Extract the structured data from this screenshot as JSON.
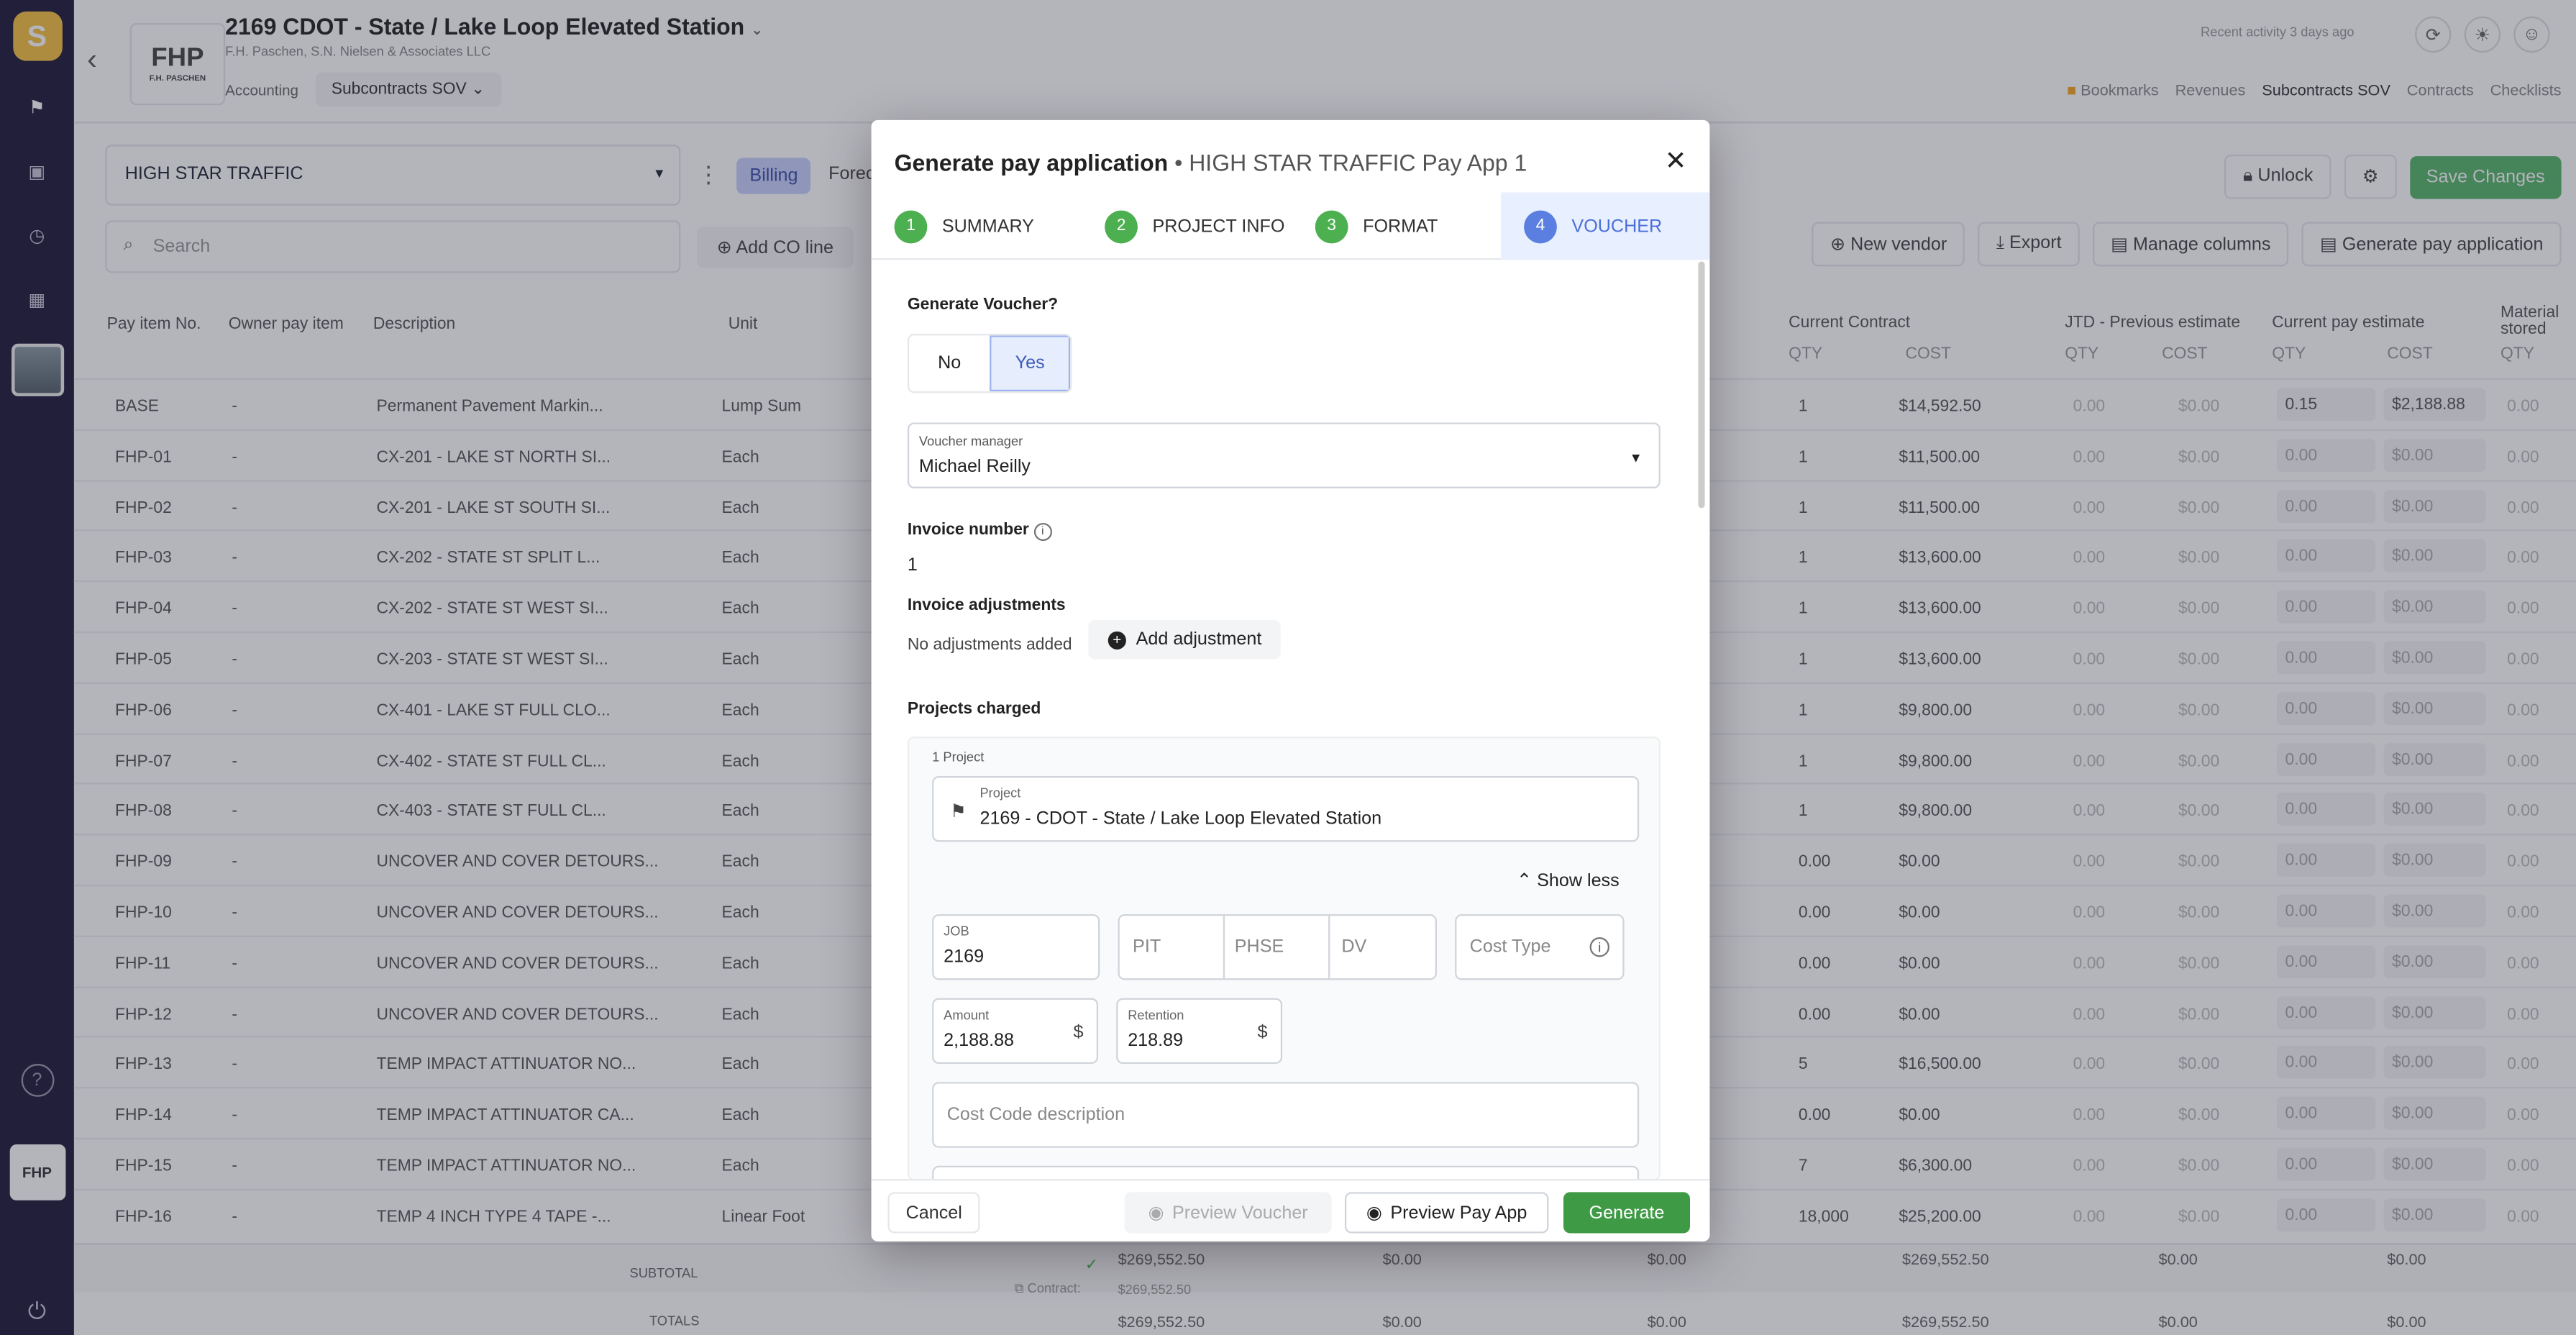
{
  "topbar": {
    "project_title": "2169 CDOT - State / Lake Loop Elevated Station",
    "project_company": "F.H. Paschen, S.N. Nielsen & Associates LLC",
    "logo_text": "FHP",
    "logo_sub": "F.H. PASCHEN",
    "crumb_accounting": "Accounting",
    "crumb_subcontracts": "Subcontracts SOV",
    "recent": "Recent activity 3 days ago",
    "nav": [
      "Bookmarks",
      "Revenues",
      "Subcontracts SOV",
      "Contracts",
      "Checklists"
    ]
  },
  "toolbar": {
    "vendor": "HIGH STAR TRAFFIC",
    "billing_tab": "Billing",
    "forecast_tab": "Forec",
    "search_placeholder": "Search",
    "add_co": "Add CO line",
    "unlock": "Unlock",
    "save": "Save Changes",
    "new_vendor": "New vendor",
    "export": "Export",
    "manage_columns": "Manage columns",
    "generate": "Generate pay application"
  },
  "table": {
    "headers": {
      "pay_item": "Pay item No.",
      "owner": "Owner pay item",
      "desc": "Description",
      "unit": "Unit",
      "current_contract": "Current Contract",
      "jtd": "JTD - Previous estimate",
      "current_pay": "Current pay estimate",
      "material": "Material stored",
      "qty": "QTY",
      "cost": "COST"
    },
    "rows": [
      {
        "no": "BASE",
        "owner": "-",
        "desc": "Permanent Pavement Markin...",
        "unit": "Lump Sum",
        "qty": "1",
        "cost": "$14,592.50",
        "pq": "0.15",
        "pc": "$2,188.88"
      },
      {
        "no": "FHP-01",
        "owner": "-",
        "desc": "CX-201 - LAKE ST NORTH SI...",
        "unit": "Each",
        "qty": "1",
        "cost": "$11,500.00",
        "pq": "0.00",
        "pc": "$0.00"
      },
      {
        "no": "FHP-02",
        "owner": "-",
        "desc": "CX-201 - LAKE ST SOUTH SI...",
        "unit": "Each",
        "qty": "1",
        "cost": "$11,500.00",
        "pq": "0.00",
        "pc": "$0.00"
      },
      {
        "no": "FHP-03",
        "owner": "-",
        "desc": "CX-202 - STATE ST SPLIT L...",
        "unit": "Each",
        "qty": "1",
        "cost": "$13,600.00",
        "pq": "0.00",
        "pc": "$0.00"
      },
      {
        "no": "FHP-04",
        "owner": "-",
        "desc": "CX-202 - STATE ST WEST SI...",
        "unit": "Each",
        "qty": "1",
        "cost": "$13,600.00",
        "pq": "0.00",
        "pc": "$0.00"
      },
      {
        "no": "FHP-05",
        "owner": "-",
        "desc": "CX-203 - STATE ST WEST SI...",
        "unit": "Each",
        "qty": "1",
        "cost": "$13,600.00",
        "pq": "0.00",
        "pc": "$0.00"
      },
      {
        "no": "FHP-06",
        "owner": "-",
        "desc": "CX-401 - LAKE ST FULL CLO...",
        "unit": "Each",
        "qty": "1",
        "cost": "$9,800.00",
        "pq": "0.00",
        "pc": "$0.00"
      },
      {
        "no": "FHP-07",
        "owner": "-",
        "desc": "CX-402 - STATE ST FULL CL...",
        "unit": "Each",
        "qty": "1",
        "cost": "$9,800.00",
        "pq": "0.00",
        "pc": "$0.00"
      },
      {
        "no": "FHP-08",
        "owner": "-",
        "desc": "CX-403 - STATE ST FULL CL...",
        "unit": "Each",
        "qty": "1",
        "cost": "$9,800.00",
        "pq": "0.00",
        "pc": "$0.00"
      },
      {
        "no": "FHP-09",
        "owner": "-",
        "desc": "UNCOVER AND COVER DETOURS...",
        "unit": "Each",
        "qty": "0.00",
        "cost": "$0.00",
        "pq": "0.00",
        "pc": "$0.00"
      },
      {
        "no": "FHP-10",
        "owner": "-",
        "desc": "UNCOVER AND COVER DETOURS...",
        "unit": "Each",
        "qty": "0.00",
        "cost": "$0.00",
        "pq": "0.00",
        "pc": "$0.00"
      },
      {
        "no": "FHP-11",
        "owner": "-",
        "desc": "UNCOVER AND COVER DETOURS...",
        "unit": "Each",
        "qty": "0.00",
        "cost": "$0.00",
        "pq": "0.00",
        "pc": "$0.00"
      },
      {
        "no": "FHP-12",
        "owner": "-",
        "desc": "UNCOVER AND COVER DETOURS...",
        "unit": "Each",
        "qty": "0.00",
        "cost": "$0.00",
        "pq": "0.00",
        "pc": "$0.00"
      },
      {
        "no": "FHP-13",
        "owner": "-",
        "desc": "TEMP IMPACT ATTINUATOR NO...",
        "unit": "Each",
        "qty": "5",
        "cost": "$16,500.00",
        "pq": "0.00",
        "pc": "$0.00"
      },
      {
        "no": "FHP-14",
        "owner": "-",
        "desc": "TEMP IMPACT ATTINUATOR CA...",
        "unit": "Each",
        "qty": "0.00",
        "cost": "$0.00",
        "pq": "0.00",
        "pc": "$0.00"
      },
      {
        "no": "FHP-15",
        "owner": "-",
        "desc": "TEMP IMPACT ATTINUATOR NO...",
        "unit": "Each",
        "qty": "7",
        "cost": "$6,300.00",
        "pq": "0.00",
        "pc": "$0.00"
      },
      {
        "no": "FHP-16",
        "owner": "-",
        "desc": "TEMP 4 INCH TYPE 4 TAPE -...",
        "unit": "Linear Foot",
        "qty": "18,000",
        "cost": "$25,200.00",
        "pq": "0.00",
        "pc": "$0.00"
      }
    ],
    "jtd_zero_qty": "0.00",
    "jtd_zero_cost": "$0.00",
    "subtotal_label": "SUBTOTAL",
    "totals_label": "TOTALS",
    "contract_label": "Contract:",
    "sub_amount": "$269,552.50",
    "zero": "$0.00"
  },
  "modal": {
    "title": "Generate pay application",
    "subtitle": "• HIGH STAR TRAFFIC Pay App 1",
    "steps": [
      {
        "n": "1",
        "label": "SUMMARY"
      },
      {
        "n": "2",
        "label": "PROJECT INFO"
      },
      {
        "n": "3",
        "label": "FORMAT"
      },
      {
        "n": "4",
        "label": "VOUCHER"
      }
    ],
    "gen_voucher_label": "Generate Voucher?",
    "no": "No",
    "yes": "Yes",
    "voucher_manager_label": "Voucher manager",
    "voucher_manager": "Michael Reilly",
    "invoice_number_label": "Invoice number",
    "invoice_number": "1",
    "adjustments_label": "Invoice adjustments",
    "no_adjustments": "No adjustments added",
    "add_adjustment": "Add adjustment",
    "projects_charged_label": "Projects charged",
    "project_count": "1 Project",
    "project_label": "Project",
    "project_value": "2169 - CDOT - State / Lake Loop Elevated Station",
    "show_less": "Show less",
    "job_label": "JOB",
    "job_value": "2169",
    "pit": "PIT",
    "phse": "PHSE",
    "dv": "DV",
    "cost_type": "Cost Type",
    "amount_label": "Amount",
    "amount_value": "2,188.88",
    "retention_label": "Retention",
    "retention_value": "218.89",
    "currency": "$",
    "cost_code_placeholder": "Cost Code description",
    "cancel": "Cancel",
    "preview_voucher": "Preview Voucher",
    "preview_pay_app": "Preview Pay App",
    "generate": "Generate"
  }
}
